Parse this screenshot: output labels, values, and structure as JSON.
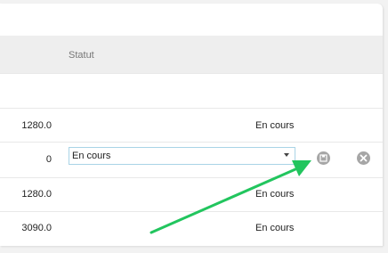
{
  "table": {
    "header": {
      "status_label": "Statut"
    },
    "rows": [
      {
        "amount": "1280.0",
        "status": "En cours"
      },
      {
        "amount": "0",
        "status_select": "En cours"
      },
      {
        "amount": "1280.0",
        "status": "En cours"
      },
      {
        "amount": "3090.0",
        "status": "En cours"
      }
    ]
  },
  "icons": {
    "save": "save-icon",
    "cancel": "close-icon"
  },
  "colors": {
    "annotation_arrow": "#22c55e",
    "select_border": "#a9d4e6",
    "header_bg": "#eeeeee",
    "icon_grey": "#a6a6a6"
  }
}
